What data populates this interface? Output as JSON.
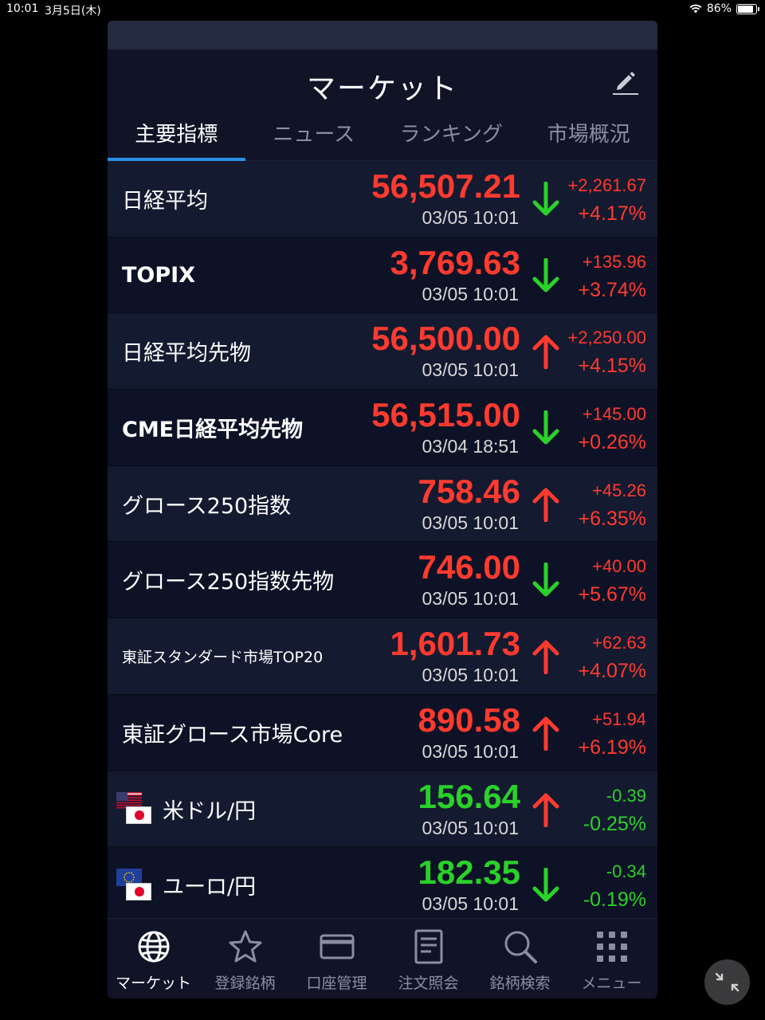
{
  "status_bar": {
    "time": "10:01",
    "date": "3月5日(木)",
    "battery_text": "86%",
    "battery_level": 0.86
  },
  "header": {
    "title": "マーケット",
    "edit_icon": "pencil-icon"
  },
  "tabs": [
    {
      "label": "主要指標",
      "active": true
    },
    {
      "label": "ニュース",
      "active": false
    },
    {
      "label": "ランキング",
      "active": false
    },
    {
      "label": "市場概況",
      "active": false
    }
  ],
  "rows": [
    {
      "name": "日経平均",
      "price": "56,507.21",
      "time": "03/05 10:01",
      "arrow": "down",
      "change": "+2,261.67",
      "pct": "+4.17%",
      "price_color": "red",
      "change_color": "red"
    },
    {
      "name": "TOPIX",
      "price": "3,769.63",
      "time": "03/05 10:01",
      "arrow": "down",
      "change": "+135.96",
      "pct": "+3.74%",
      "price_color": "red",
      "change_color": "red"
    },
    {
      "name": "日経平均先物",
      "price": "56,500.00",
      "time": "03/05 10:01",
      "arrow": "up",
      "change": "+2,250.00",
      "pct": "+4.15%",
      "price_color": "red",
      "change_color": "red"
    },
    {
      "name": "CME日経平均先物",
      "price": "56,515.00",
      "time": "03/04 18:51",
      "arrow": "down",
      "change": "+145.00",
      "pct": "+0.26%",
      "price_color": "red",
      "change_color": "red"
    },
    {
      "name": "グロース250指数",
      "price": "758.46",
      "time": "03/05 10:01",
      "arrow": "up",
      "change": "+45.26",
      "pct": "+6.35%",
      "price_color": "red",
      "change_color": "red"
    },
    {
      "name": "グロース250指数先物",
      "price": "746.00",
      "time": "03/05 10:01",
      "arrow": "down",
      "change": "+40.00",
      "pct": "+5.67%",
      "price_color": "red",
      "change_color": "red"
    },
    {
      "name": "東証スタンダード市場TOP20",
      "price": "1,601.73",
      "time": "03/05 10:01",
      "arrow": "up",
      "change": "+62.63",
      "pct": "+4.07%",
      "price_color": "red",
      "change_color": "red"
    },
    {
      "name": "東証グロース市場Core",
      "price": "890.58",
      "time": "03/05 10:01",
      "arrow": "up",
      "change": "+51.94",
      "pct": "+6.19%",
      "price_color": "red",
      "change_color": "red"
    },
    {
      "name": "米ドル/円",
      "price": "156.64",
      "time": "03/05 10:01",
      "arrow": "up",
      "change": "-0.39",
      "pct": "-0.25%",
      "price_color": "green",
      "change_color": "green",
      "flags": [
        "us-flag",
        "jp-flag"
      ]
    },
    {
      "name": "ユーロ/円",
      "price": "182.35",
      "time": "03/05 10:01",
      "arrow": "down",
      "change": "-0.34",
      "pct": "-0.19%",
      "price_color": "green",
      "change_color": "green",
      "flags": [
        "eu-flag",
        "jp-flag"
      ]
    }
  ],
  "bottom_nav": [
    {
      "label": "マーケット",
      "icon": "globe-icon",
      "active": true
    },
    {
      "label": "登録銘柄",
      "icon": "star-icon",
      "active": false
    },
    {
      "label": "口座管理",
      "icon": "card-icon",
      "active": false
    },
    {
      "label": "注文照会",
      "icon": "document-icon",
      "active": false
    },
    {
      "label": "銘柄検索",
      "icon": "search-icon",
      "active": false
    },
    {
      "label": "メニュー",
      "icon": "grid-menu-icon",
      "active": false
    }
  ],
  "colors": {
    "up_red": "#ff3b2f",
    "down_green": "#2ad12a",
    "accent_blue": "#2b8ee6"
  }
}
